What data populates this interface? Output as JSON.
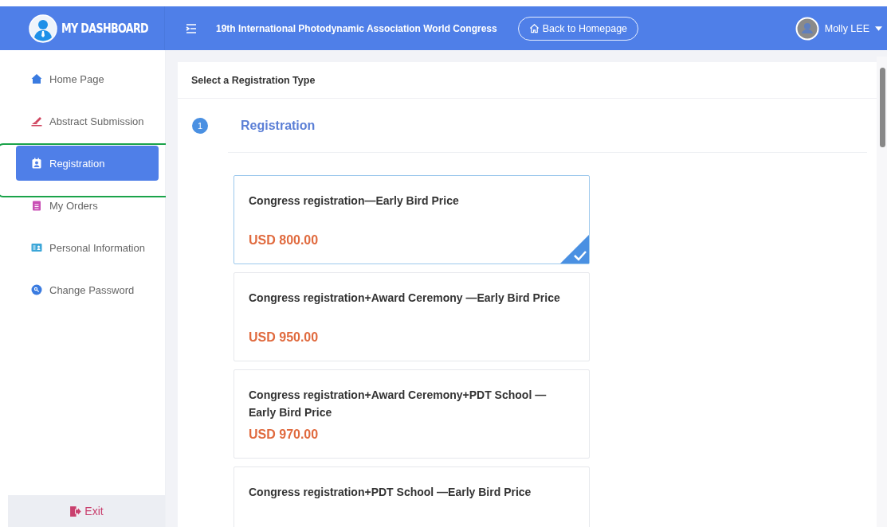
{
  "header": {
    "logo_text": "MY DASHBOARD",
    "title": "19th International Photodynamic Association World Congress",
    "back_button": "Back to Homepage",
    "user_name": "Molly LEE"
  },
  "sidebar": {
    "items": [
      {
        "label": "Home Page",
        "kind": "home",
        "selected": false
      },
      {
        "label": "Abstract Submission",
        "kind": "submit",
        "selected": false
      },
      {
        "label": "Registration",
        "kind": "registration",
        "selected": true
      },
      {
        "label": "My Orders",
        "kind": "orders",
        "selected": false
      },
      {
        "label": "Personal Information",
        "kind": "profile",
        "selected": false
      },
      {
        "label": "Change Password",
        "kind": "password",
        "selected": false
      }
    ],
    "exit_button": "Exit"
  },
  "panel": {
    "title": "Select a Registration Type",
    "step": {
      "number": "1",
      "label": "Registration"
    },
    "options": [
      {
        "title": "Congress registration—Early Bird Price",
        "price": "USD 800.00",
        "selected": true
      },
      {
        "title": "Congress registration+Award Ceremony —Early Bird Price",
        "price": "USD 950.00",
        "selected": false
      },
      {
        "title": "Congress registration+Award Ceremony+PDT School —Early Bird Price",
        "price": "USD 970.00",
        "selected": false
      },
      {
        "title": "Congress registration+PDT School —Early Bird Price",
        "selected": false
      }
    ]
  }
}
